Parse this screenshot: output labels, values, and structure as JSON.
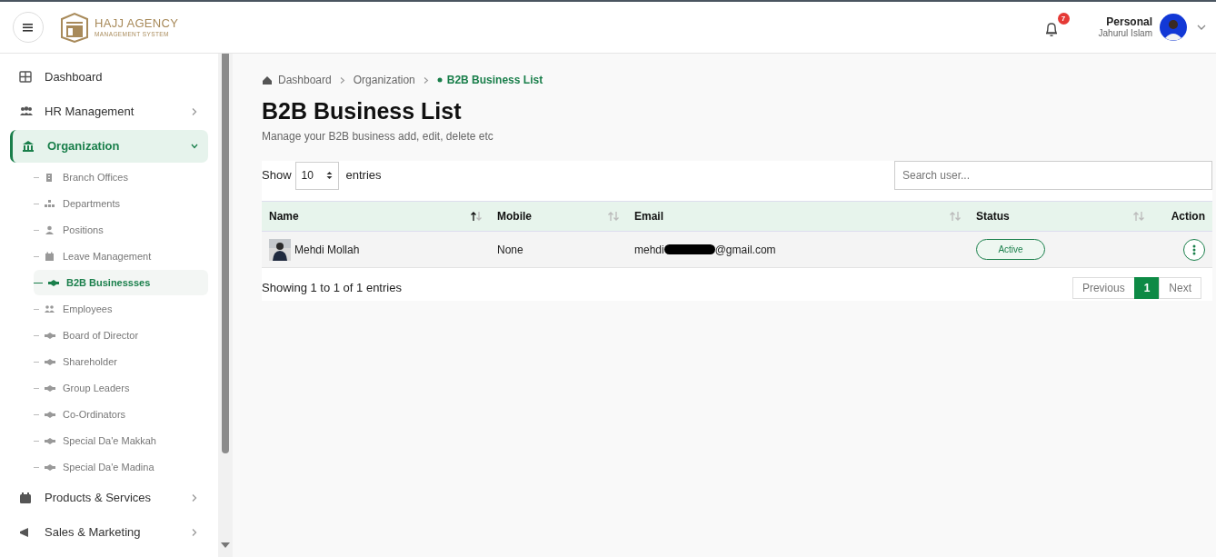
{
  "header": {
    "brand": {
      "title": "HAJJ AGENCY",
      "subtitle": "MANAGEMENT SYSTEM"
    },
    "notifications": {
      "count": "7"
    },
    "user": {
      "role": "Personal",
      "name": "Jahurul Islam"
    }
  },
  "sidebar": {
    "items": [
      {
        "label": "Dashboard",
        "selected": false
      },
      {
        "label": "HR Management",
        "selected": false,
        "expanded": false
      },
      {
        "label": "Organization",
        "selected": true,
        "expanded": true,
        "children": [
          {
            "label": "Branch Offices",
            "selected": false
          },
          {
            "label": "Departments",
            "selected": false
          },
          {
            "label": "Positions",
            "selected": false
          },
          {
            "label": "Leave Management",
            "selected": false
          },
          {
            "label": "B2B Businessses",
            "selected": true
          },
          {
            "label": "Employees",
            "selected": false
          },
          {
            "label": "Board of Director",
            "selected": false
          },
          {
            "label": "Shareholder",
            "selected": false
          },
          {
            "label": "Group Leaders",
            "selected": false
          },
          {
            "label": "Co-Ordinators",
            "selected": false
          },
          {
            "label": "Special Da'e Makkah",
            "selected": false
          },
          {
            "label": "Special Da'e Madina",
            "selected": false
          }
        ]
      },
      {
        "label": "Products & Services",
        "selected": false,
        "expanded": false
      },
      {
        "label": "Sales & Marketing",
        "selected": false,
        "expanded": false
      }
    ]
  },
  "breadcrumb": [
    {
      "label": "Dashboard",
      "current": false
    },
    {
      "label": "Organization",
      "current": false
    },
    {
      "label": "B2B Business List",
      "current": true
    }
  ],
  "page": {
    "title": "B2B Business List",
    "subtitle": "Manage your B2B business add, edit, delete etc"
  },
  "table_controls": {
    "show_label": "Show",
    "page_size": "10",
    "entries_label": "entries",
    "search_placeholder": "Search user..."
  },
  "table": {
    "columns": [
      {
        "label": "Name",
        "sorted": true
      },
      {
        "label": "Mobile",
        "sorted": false
      },
      {
        "label": "Email",
        "sorted": false
      },
      {
        "label": "Status",
        "sorted": false
      },
      {
        "label": "Action"
      }
    ],
    "rows": [
      {
        "name": "Mehdi Mollah",
        "mobile": "None",
        "email_start": "mehdi",
        "email_end": "@gmail.com",
        "email_redacted": true,
        "status": "Active"
      }
    ]
  },
  "footer": {
    "info": "Showing 1 to 1 of 1 entries",
    "pagination": [
      {
        "label": "Previous",
        "selected": false
      },
      {
        "label": "1",
        "selected": true
      },
      {
        "label": "Next",
        "selected": false
      }
    ]
  }
}
